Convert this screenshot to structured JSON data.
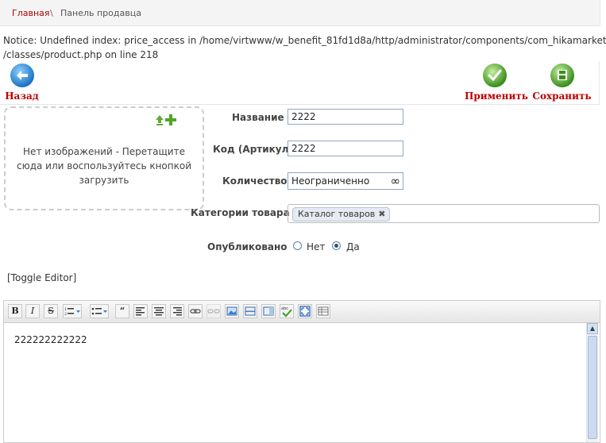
{
  "breadcrumb": {
    "home": "Главная",
    "separator": "\\",
    "current": "Панель продавца"
  },
  "notice": {
    "line1": "Notice: Undefined index: price_access in /home/virtwww/w_benefit_81fd1d8a/http/administrator/components/com_hikamarket",
    "line2": "/classes/product.php on line 218"
  },
  "toolbar": {
    "back_label": "Назад",
    "apply_label": "Применить",
    "save_label": "Сохранить"
  },
  "images": {
    "empty_text": "Нет изображений - Перетащите сюда или воспользуйтесь кнопкой загрузить"
  },
  "form": {
    "name_label": "Название",
    "name_value": "2222",
    "code_label": "Код (Артикул)",
    "code_value": "2222",
    "quantity_label": "Количество",
    "quantity_value": "Неограниченно",
    "quantity_symbol": "∞",
    "categories_label": "Категории товара",
    "category_tag": "Каталог товаров",
    "category_remove": "✖",
    "published_label": "Опубликовано",
    "published_options": [
      "Нет",
      "Да"
    ],
    "published_selected": "Да"
  },
  "editor": {
    "toggle": "[Toggle Editor]",
    "content": "222222222222",
    "buttons": [
      "bold",
      "italic",
      "strikethrough",
      "ordered-list",
      "bullet-list",
      "blockquote",
      "align-left",
      "align-center",
      "align-right",
      "link",
      "unlink",
      "image",
      "horizontal-rule",
      "page-break",
      "spellcheck",
      "fullscreen",
      "table"
    ]
  },
  "colors": {
    "accent_red": "#b00000",
    "back_blue": "#2e8ad6",
    "ok_green": "#3f9b1f",
    "input_border": "#8aa8c6"
  }
}
